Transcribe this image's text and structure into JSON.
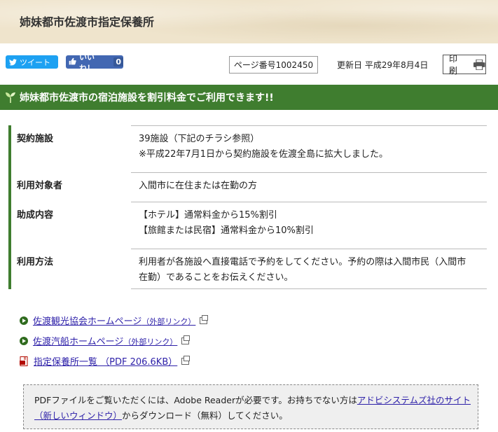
{
  "header": {
    "title": "姉妹都市佐渡市指定保養所"
  },
  "social": {
    "tweet_label": "ツイート",
    "like_label": "いいね！",
    "like_count": "0"
  },
  "meta": {
    "page_number": "ページ番号1002450",
    "updated": "更新日 平成29年8月4日",
    "print_label": "印刷"
  },
  "banner": {
    "text": "姉妹都市佐渡市の宿泊施設を割引料金でご利用できます!!"
  },
  "rows": [
    {
      "label": "契約施設",
      "lines": [
        "39施設（下記のチラシ参照）",
        "※平成22年7月1日から契約施設を佐渡全島に拡大しました。"
      ]
    },
    {
      "label": "利用対象者",
      "lines": [
        "入間市に在住または在勤の方"
      ]
    },
    {
      "label": "助成内容",
      "lines": [
        "【ホテル】通常料金から15%割引",
        "【旅館または民宿】通常料金から10%割引"
      ]
    },
    {
      "label": "利用方法",
      "lines": [
        "利用者が各施設へ直接電話で予約をしてください。予約の際は入間市民（入間市",
        "在勤）であることをお伝えください。"
      ]
    }
  ],
  "links": [
    {
      "text": "佐渡観光協会ホームページ",
      "suffix": "（外部リンク）"
    },
    {
      "text": "佐渡汽船ホームページ",
      "suffix": "（外部リンク）"
    },
    {
      "text": "指定保養所一覧 （PDF 206.6KB）",
      "suffix": ""
    }
  ],
  "notice": {
    "prefix": "PDFファイルをご覧いただくには、Adobe Readerが必要です。お持ちでない方は",
    "link1": "アドビシステムズ社のサイト",
    "link2": "（新しいウィンドウ）",
    "suffix": "からダウンロード（無料）してください。"
  },
  "colors": {
    "accent_green": "#3f7d2f",
    "link": "#2c1fa8",
    "twitter": "#1da1f2",
    "facebook": "#4267b2"
  }
}
